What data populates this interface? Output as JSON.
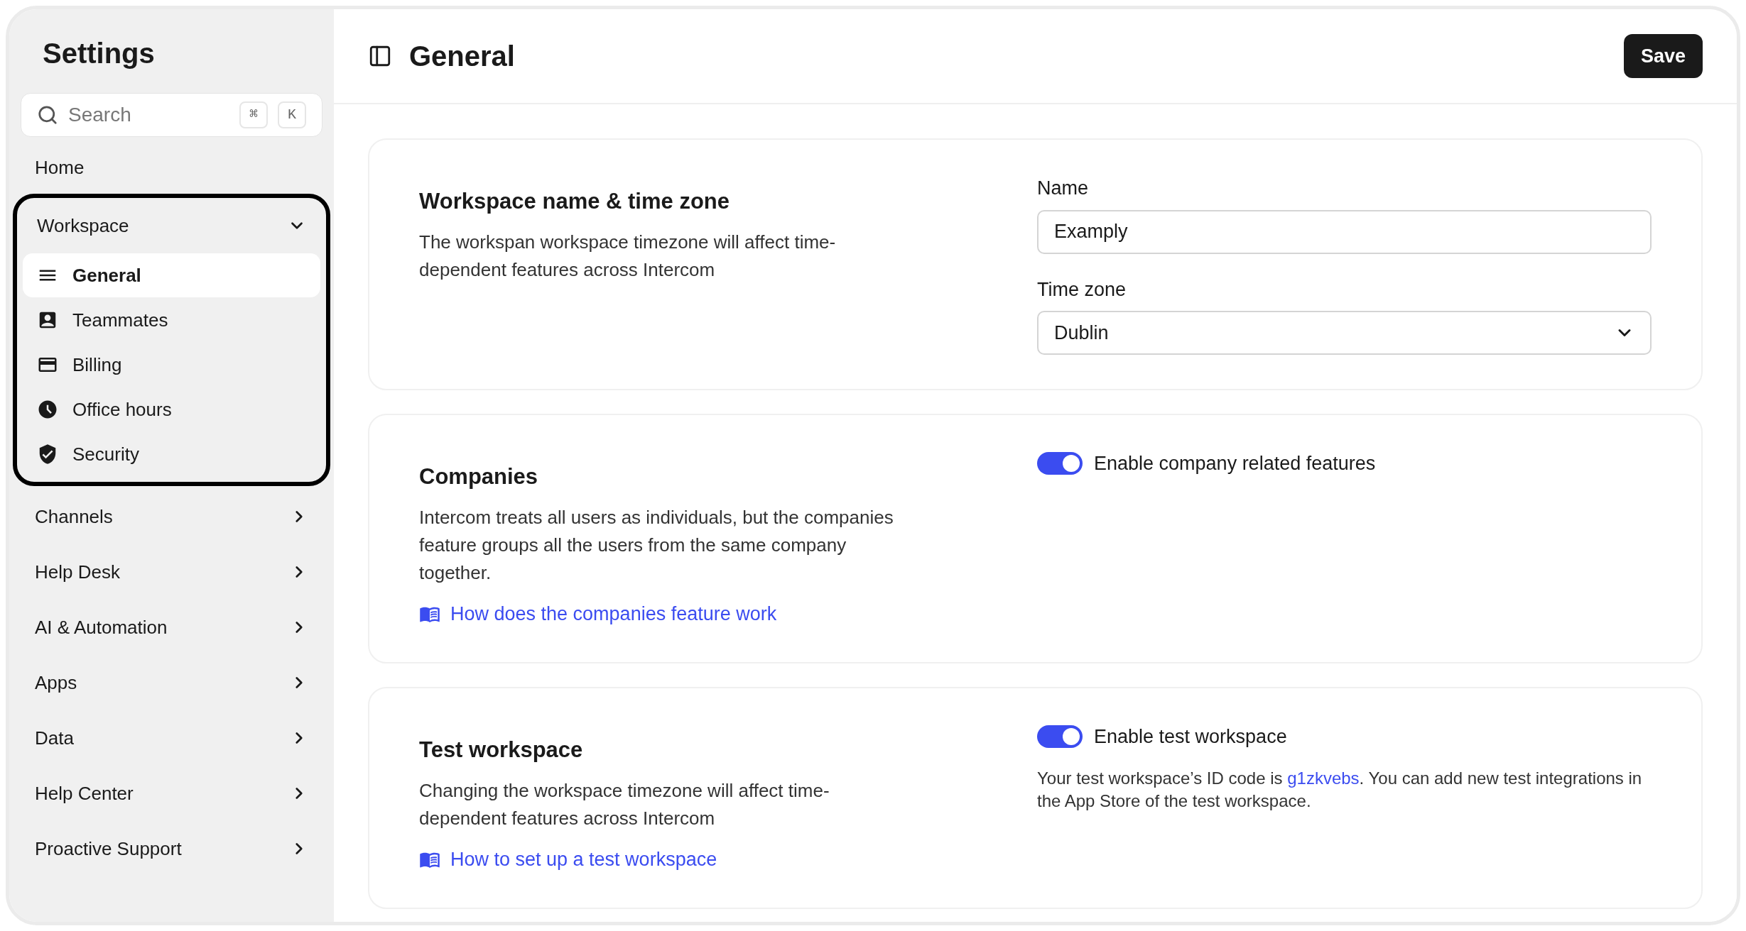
{
  "sidebar": {
    "title": "Settings",
    "search": {
      "placeholder": "Search",
      "keys": [
        "⌘",
        "K"
      ]
    },
    "items": [
      {
        "kind": "link",
        "label": "Home"
      },
      {
        "kind": "group",
        "label": "Workspace",
        "expanded": true,
        "highlighted": true,
        "children": [
          {
            "label": "General",
            "selected": true
          },
          {
            "label": "Teammates",
            "selected": false
          },
          {
            "label": "Billing",
            "selected": false
          },
          {
            "label": "Office hours",
            "selected": false
          },
          {
            "label": "Security",
            "selected": false
          }
        ]
      },
      {
        "kind": "group",
        "label": "Channels",
        "expanded": false,
        "highlighted": false
      },
      {
        "kind": "group",
        "label": "Help Desk",
        "expanded": false,
        "highlighted": false
      },
      {
        "kind": "group",
        "label": "AI & Automation",
        "expanded": false,
        "highlighted": false
      },
      {
        "kind": "group",
        "label": "Apps",
        "expanded": false,
        "highlighted": false
      },
      {
        "kind": "group",
        "label": "Data",
        "expanded": false,
        "highlighted": false
      },
      {
        "kind": "group",
        "label": "Help Center",
        "expanded": false,
        "highlighted": false
      },
      {
        "kind": "group",
        "label": "Proactive Support",
        "expanded": false,
        "highlighted": false
      }
    ]
  },
  "header": {
    "title": "General",
    "save_button": "Save"
  },
  "sections": [
    {
      "title": "Workspace name & time zone",
      "description": "The workspan workspace timezone will affect time-dependent features across Intercom",
      "controls": [
        {
          "kind": "text",
          "label": "Name",
          "value": "Examply"
        },
        {
          "kind": "select",
          "label": "Time zone",
          "value": "Dublin"
        }
      ]
    },
    {
      "title": "Companies",
      "description": "Intercom treats all users as individuals, but the companies feature groups all the users from the same company together.",
      "link": "How does the companies feature work",
      "controls": [
        {
          "kind": "toggle",
          "label": "Enable company related features",
          "on": true
        }
      ]
    },
    {
      "title": "Test workspace",
      "description": "Changing the workspace timezone will affect time-dependent features across Intercom",
      "link": "How to set up a test workspace",
      "controls": [
        {
          "kind": "toggle",
          "label": "Enable test workspace",
          "on": true
        },
        {
          "kind": "note",
          "before": "Your test workspace’s ID code is",
          "link": "g1zkvebs",
          "after": ". You can add new test integrations in the App Store of the test workspace."
        }
      ]
    }
  ]
}
